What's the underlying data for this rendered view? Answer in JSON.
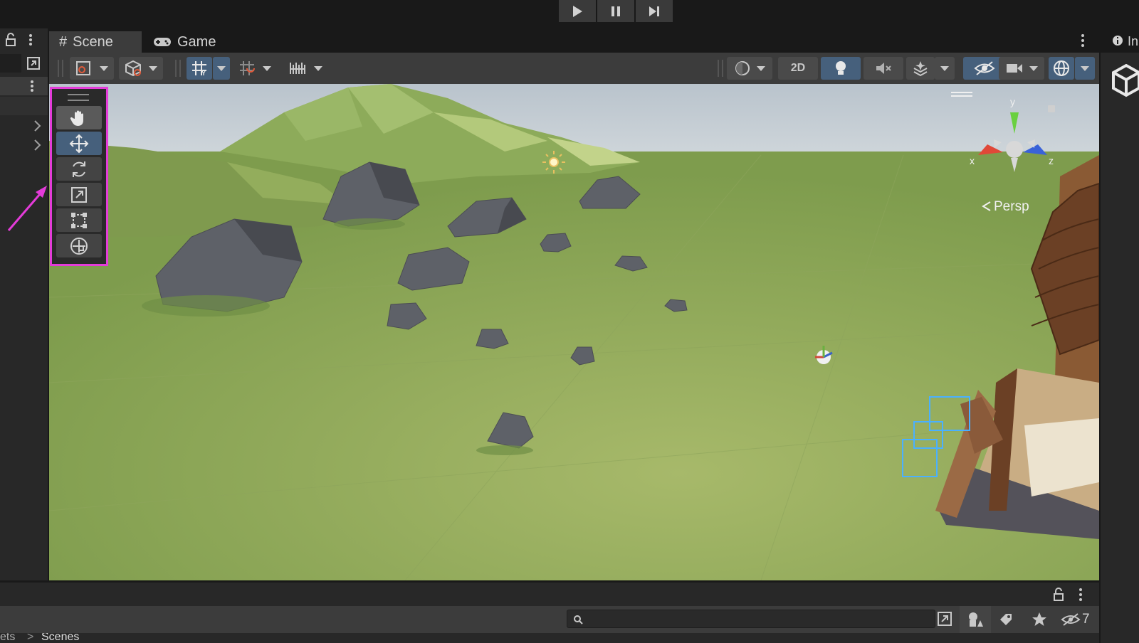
{
  "tabs": [
    {
      "label": "Scene",
      "icon": "grid-hash-icon"
    },
    {
      "label": "Game",
      "icon": "gamepad-icon"
    }
  ],
  "toolbar": {
    "mode_2d_label": "2D"
  },
  "scene": {
    "projection_label": "Persp",
    "gizmo_axes": {
      "x": "x",
      "y": "y",
      "z": "z"
    }
  },
  "inspector": {
    "tab_label_partial": "In"
  },
  "bottom": {
    "search_placeholder": "",
    "hidden_count": "7"
  },
  "breadcrumb": {
    "parent": "ets",
    "separator": ">",
    "current": "Scenes"
  },
  "colors": {
    "highlight": "#e43bd9",
    "accent_active": "#46607c",
    "ground": "#8aa757"
  }
}
